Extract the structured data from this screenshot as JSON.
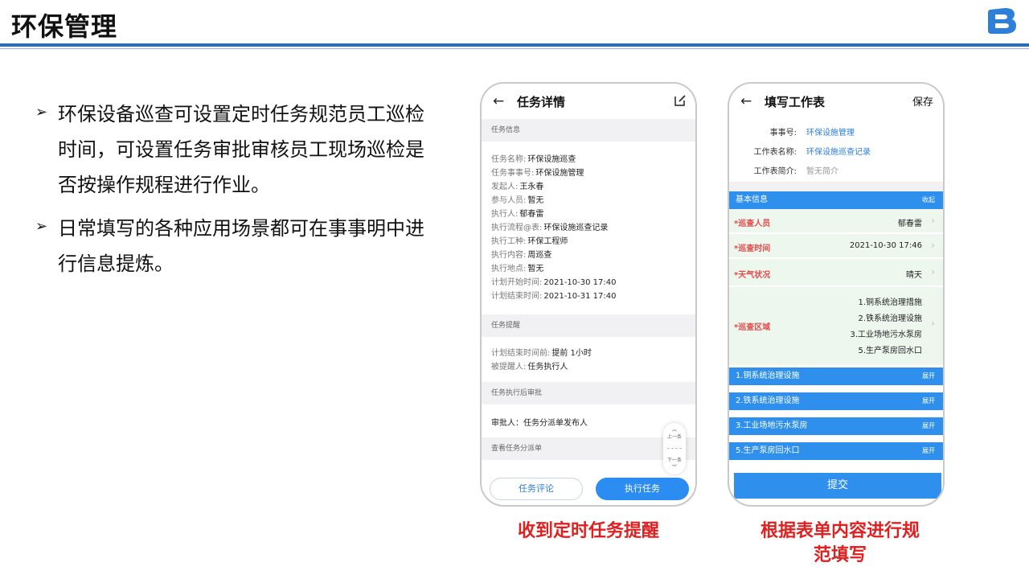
{
  "slide": {
    "title": "环保管理",
    "bullets": [
      "环保设备巡查可设置定时任务规范员工巡检时间，可设置任务审批审核员工现场巡检是否按操作规程进行作业。",
      "日常填写的各种应用场景都可在事事明中进行信息提炼。"
    ],
    "captions": [
      "收到定时任务提醒",
      "根据表单内容进行规范填写"
    ]
  },
  "phone1": {
    "back_icon": "arrow-left-icon",
    "title": "任务详情",
    "edit_icon": "edit-icon",
    "section_info": "任务信息",
    "info": [
      {
        "k": "任务名称:",
        "v": "环保设施巡查"
      },
      {
        "k": "任务事事号:",
        "v": "环保设施管理"
      },
      {
        "k": "发起人:",
        "v": "王永春"
      },
      {
        "k": "参与人员:",
        "v": "暂无"
      },
      {
        "k": "执行人:",
        "v": "郁春雷"
      },
      {
        "k": "执行流程@表:",
        "v": "环保设施巡查记录"
      },
      {
        "k": "执行工种:",
        "v": "环保工程师"
      },
      {
        "k": "执行内容:",
        "v": "周巡查"
      },
      {
        "k": "执行地点:",
        "v": "暂无"
      },
      {
        "k": "计划开始时间:",
        "v": "2021-10-30 17:40"
      },
      {
        "k": "计划结束时间:",
        "v": "2021-10-31 17:40"
      }
    ],
    "section_remind": "任务提醒",
    "remind": [
      {
        "k": "计划结束时间前:",
        "v": "提前 1小时"
      },
      {
        "k": "被提醒人:",
        "v": "任务执行人"
      }
    ],
    "section_approve": "任务执行后审批",
    "approver": "审批人：任务分派单发布人",
    "section_dispatch": "查看任务分派单",
    "scroll_up": "上一条",
    "scroll_down": "下一条",
    "btn_comment": "任务评论",
    "btn_execute": "执行任务"
  },
  "phone2": {
    "back_icon": "arrow-left-icon",
    "title": "填写工作表",
    "save": "保存",
    "top": [
      {
        "k": "事事号:",
        "v": "环保设施管理"
      },
      {
        "k": "工作表名称:",
        "v": "环保设施巡查记录"
      },
      {
        "k": "工作表简介:",
        "v": "暂无简介"
      }
    ],
    "basic_bar": {
      "label": "基本信息",
      "action": "收起"
    },
    "fields": [
      {
        "label": "*巡查人员",
        "value": "郁春雷"
      },
      {
        "label": "*巡查时间",
        "value": "2021-10-30 17:46"
      },
      {
        "label": "*天气状况",
        "value": "晴天"
      }
    ],
    "area": {
      "label": "*巡查区域",
      "values": [
        "1.铜系统治理措施",
        "2.铁系统治理设施",
        "3.工业场地污水泵房",
        "5.生产泵房回水口"
      ]
    },
    "sections": [
      {
        "label": "1.铜系统治理设施",
        "action": "展开"
      },
      {
        "label": "2.铁系统治理设施",
        "action": "展开"
      },
      {
        "label": "3.工业场地污水泵房",
        "action": "展开"
      },
      {
        "label": "5.生产泵房回水口",
        "action": "展开"
      }
    ],
    "submit": "提交"
  }
}
